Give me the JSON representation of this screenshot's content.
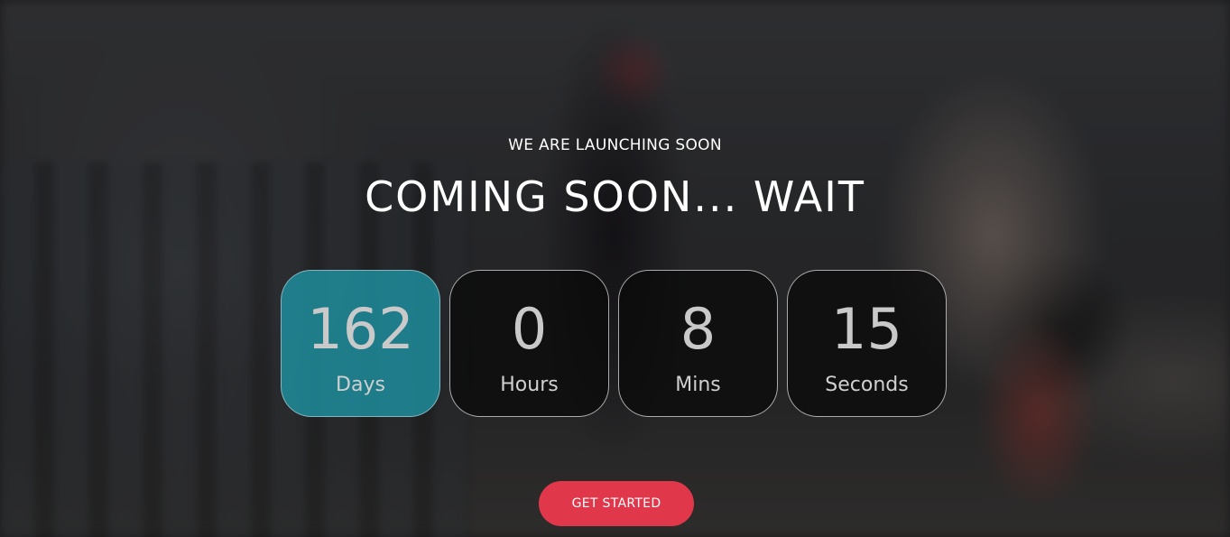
{
  "hero": {
    "subtitle": "WE ARE LAUNCHING SOON",
    "title": "COMING SOON... WAIT"
  },
  "countdown": [
    {
      "value": "162",
      "label": "Days"
    },
    {
      "value": "0",
      "label": "Hours"
    },
    {
      "value": "8",
      "label": "Mins"
    },
    {
      "value": "15",
      "label": "Seconds"
    }
  ],
  "cta": {
    "label": "GET STARTED"
  },
  "colors": {
    "accent_teal": "#1e8c9b",
    "button_red": "#e0384a",
    "box_dark": "#0a0a0a",
    "text_white": "#ffffff"
  }
}
